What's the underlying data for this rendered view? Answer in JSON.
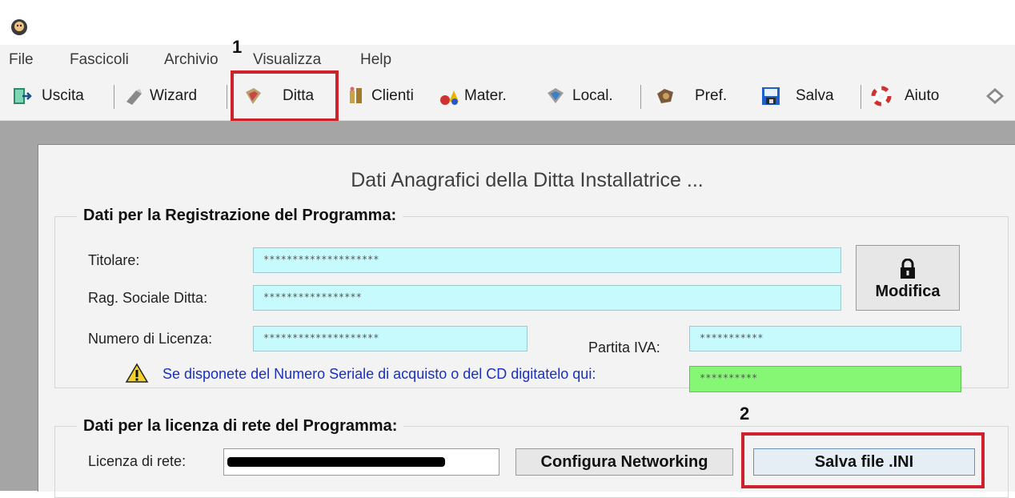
{
  "menu": {
    "items": [
      "File",
      "Fascicoli",
      "Archivio",
      "Visualizza",
      "Help"
    ]
  },
  "toolbar": {
    "uscita": "Uscita",
    "wizard": "Wizard",
    "ditta": "Ditta",
    "clienti": "Clienti",
    "mater": "Mater.",
    "local": "Local.",
    "pref": "Pref.",
    "salva": "Salva",
    "aiuto": "Aiuto"
  },
  "annotations": {
    "one": "1",
    "two": "2"
  },
  "dialog": {
    "title": "Dati Anagrafici della Ditta Installatrice ...",
    "registration": {
      "legend": "Dati per la Registrazione del Programma:",
      "titolare_label": "Titolare:",
      "titolare_value": "********************",
      "ragsoc_label": "Rag. Sociale Ditta:",
      "ragsoc_value": "*****************",
      "licenza_label": "Numero di Licenza:",
      "licenza_value": "********************",
      "piva_label": "Partita IVA:",
      "piva_value": "***********",
      "seriale_text": "Se disponete del Numero Seriale di acquisto o del CD digitatelo qui:",
      "seriale_value": "**********",
      "modifica_label": "Modifica"
    },
    "network": {
      "legend": "Dati per la licenza di rete del Programma:",
      "licenza_rete_label": "Licenza di rete:",
      "configura_label": "Configura Networking",
      "salva_ini_label": "Salva file .INI"
    }
  },
  "colors": {
    "field_cyan": "#c6fafd",
    "field_green": "#85f774",
    "annotation_red": "#d0202c",
    "link_blue": "#1a2fbf"
  }
}
